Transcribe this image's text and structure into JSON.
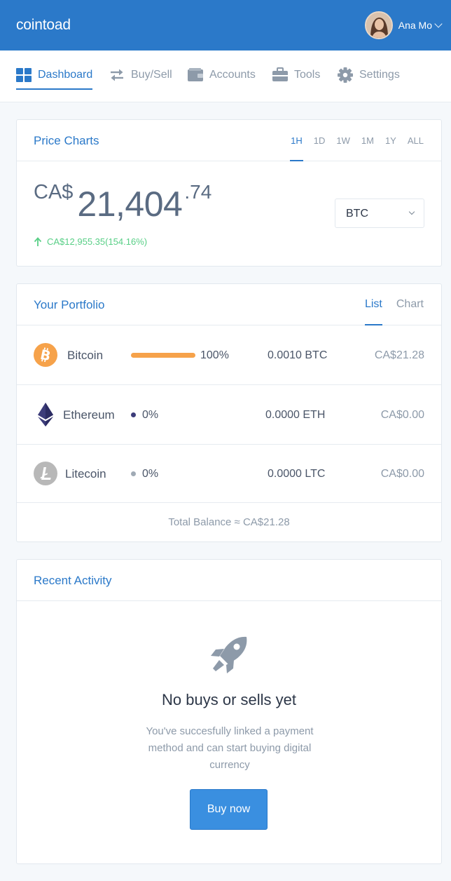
{
  "app": {
    "brand": "cointoad"
  },
  "user": {
    "name": "Ana Mo"
  },
  "nav": {
    "items": [
      {
        "label": "Dashboard",
        "icon": "dashboard-grid-icon",
        "active": true
      },
      {
        "label": "Buy/Sell",
        "icon": "swap-arrows-icon",
        "active": false
      },
      {
        "label": "Accounts",
        "icon": "wallet-icon",
        "active": false
      },
      {
        "label": "Tools",
        "icon": "briefcase-icon",
        "active": false
      },
      {
        "label": "Settings",
        "icon": "gear-icon",
        "active": false
      }
    ]
  },
  "price_charts": {
    "title": "Price Charts",
    "ranges": [
      "1H",
      "1D",
      "1W",
      "1M",
      "1Y",
      "ALL"
    ],
    "active_range": "1H",
    "currency_label": "CA$",
    "price_integer": "21,404",
    "price_decimal": ".74",
    "change_text": "CA$12,955.35(154.16%)",
    "change_direction": "up",
    "selected_coin": "BTC"
  },
  "portfolio": {
    "title": "Your Portfolio",
    "tabs": [
      "List",
      "Chart"
    ],
    "active_tab": "List",
    "rows": [
      {
        "name": "Bitcoin",
        "icon": "bitcoin-icon",
        "percent": "100%",
        "amount": "0.0010 BTC",
        "value": "CA$21.28",
        "share": 1.0
      },
      {
        "name": "Ethereum",
        "icon": "ethereum-icon",
        "percent": "0%",
        "amount": "0.0000 ETH",
        "value": "CA$0.00",
        "share": 0.0
      },
      {
        "name": "Litecoin",
        "icon": "litecoin-icon",
        "percent": "0%",
        "amount": "0.0000 LTC",
        "value": "CA$0.00",
        "share": 0.0
      }
    ],
    "total": "Total Balance ≈ CA$21.28"
  },
  "activity": {
    "title": "Recent Activity",
    "empty_title": "No buys or sells yet",
    "empty_text": "You've succesfully linked a payment method and can start buying digital currency",
    "button_label": "Buy now"
  },
  "colors": {
    "brand_blue": "#2b79c9",
    "positive_green": "#58cf86",
    "bitcoin_orange": "#f6a24a",
    "ethereum_purple": "#3c3c7a",
    "litecoin_gray": "#b8b8b8"
  }
}
